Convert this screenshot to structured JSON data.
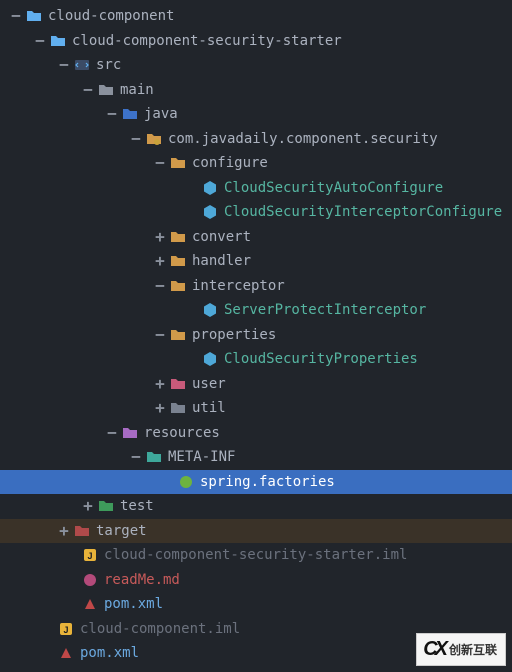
{
  "toggle": {
    "minus": "−",
    "plus": "+"
  },
  "tree": {
    "root": "cloud-component",
    "starter": "cloud-component-security-starter",
    "src": "src",
    "main": "main",
    "java": "java",
    "pkg": "com.javadaily.component.security",
    "configure": "configure",
    "autoConfigure": "CloudSecurityAutoConfigure",
    "interceptorConfigure": "CloudSecurityInterceptorConfigure",
    "convert": "convert",
    "handler": "handler",
    "interceptor": "interceptor",
    "serverProtect": "ServerProtectInterceptor",
    "properties": "properties",
    "cloudSecProps": "CloudSecurityProperties",
    "user": "user",
    "util": "util",
    "resources": "resources",
    "metaInf": "META-INF",
    "springFactories": "spring.factories",
    "test": "test",
    "target": "target",
    "iml2": "cloud-component-security-starter.iml",
    "readme": "readMe.md",
    "pom2": "pom.xml",
    "iml1": "cloud-component.iml",
    "pom1": "pom.xml"
  },
  "logo": {
    "mark": "CX",
    "text": "创新互联"
  }
}
